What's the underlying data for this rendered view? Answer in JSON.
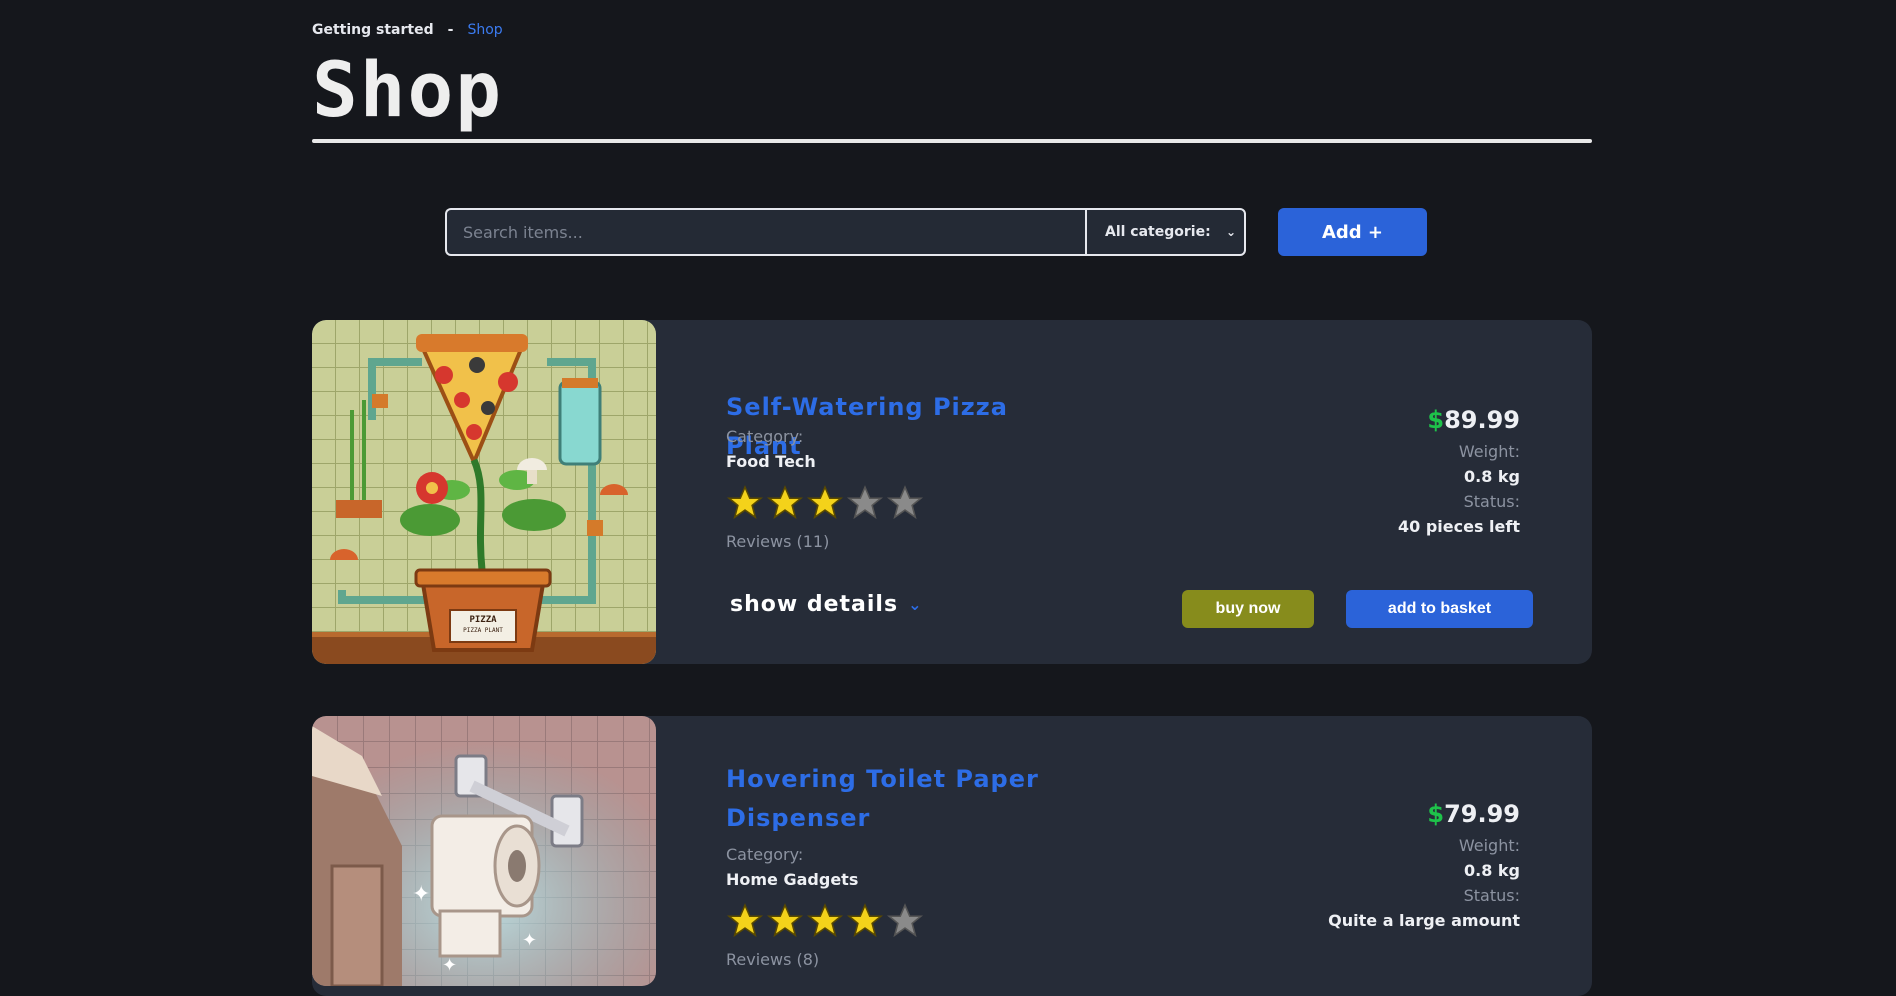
{
  "breadcrumb": {
    "parent": "Getting started",
    "separator": "-",
    "current": "Shop"
  },
  "page": {
    "title": "Shop"
  },
  "toolbar": {
    "search_placeholder": "Search items...",
    "category_selected": "All categorie:",
    "add_label": "Add +"
  },
  "colors": {
    "accent": "#2b63d9",
    "price_currency": "#1ec24a",
    "buy": "#878c1c",
    "star_filled": "#f4d21a",
    "star_empty": "#8a8a8a"
  },
  "products": [
    {
      "name": "Self-Watering Pizza Plant",
      "category_label": "Category:",
      "category": "Food Tech",
      "rating": 3,
      "rating_max": 5,
      "reviews": "Reviews (11)",
      "price_currency": "$",
      "price": "89.99",
      "weight_label": "Weight:",
      "weight": "0.8 kg",
      "status_label": "Status:",
      "status": "40 pieces left",
      "details_label": "show details",
      "buy_label": "buy now",
      "basket_label": "add to basket",
      "image_icon": "pizza-plant-illustration",
      "image_text": "PIZZA PIZZA PLANT"
    },
    {
      "name": "Hovering Toilet Paper Dispenser",
      "category_label": "Category:",
      "category": "Home Gadgets",
      "rating": 4,
      "rating_max": 5,
      "reviews": "Reviews (8)",
      "price_currency": "$",
      "price": "79.99",
      "weight_label": "Weight:",
      "weight": "0.8 kg",
      "status_label": "Status:",
      "status": "Quite a large amount",
      "image_icon": "toilet-paper-illustration"
    }
  ]
}
